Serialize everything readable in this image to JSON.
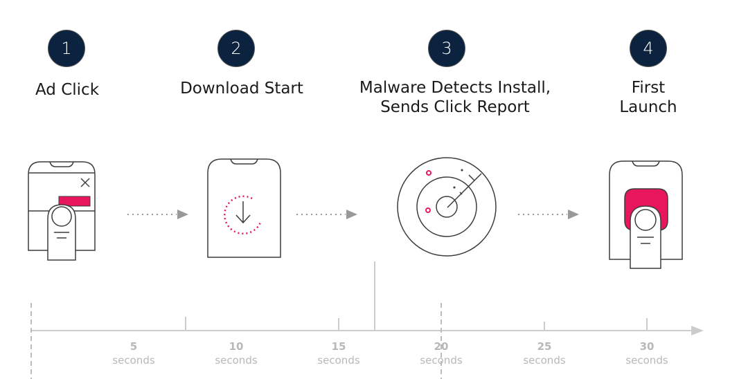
{
  "steps": [
    {
      "number": "1",
      "title_lines": [
        "Ad Click"
      ],
      "icon": "phone-ad-tap-icon"
    },
    {
      "number": "2",
      "title_lines": [
        "Download Start"
      ],
      "icon": "phone-download-icon"
    },
    {
      "number": "3",
      "title_lines": [
        "Malware Detects Install,",
        "Sends Click Report"
      ],
      "icon": "radar-icon"
    },
    {
      "number": "4",
      "title_lines": [
        "First",
        "Launch"
      ],
      "icon": "phone-launch-icon"
    }
  ],
  "timeline": {
    "unit_label": "seconds",
    "ticks": [
      "5",
      "10",
      "15",
      "20",
      "25",
      "30"
    ]
  },
  "colors": {
    "accent": "#e8175d",
    "badge": "#0c233f",
    "outline": "#3c3c3c",
    "axis": "#cccccc",
    "arrow": "#999999"
  }
}
